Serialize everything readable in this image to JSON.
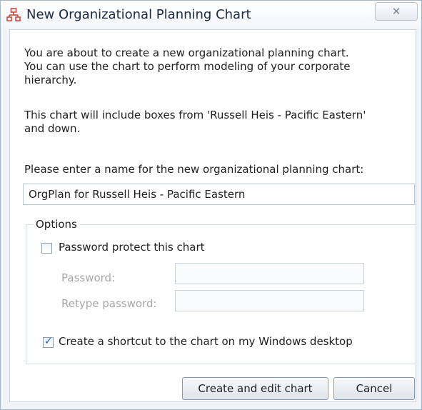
{
  "window": {
    "title": "New Organizational Planning Chart",
    "close_glyph": "✕"
  },
  "intro_text": "You are about to create a new organizational planning chart.\nYou can use the chart to perform modeling of your corporate hierarchy.",
  "scope_text": "This chart will include boxes from 'Russell Heis - Pacific Eastern'\nand down.",
  "name_prompt": "Please enter a name for the new organizational planning chart:",
  "name_value": "OrgPlan for Russell Heis - Pacific Eastern",
  "options": {
    "legend": "Options",
    "password_protect": {
      "label": "Password protect this chart",
      "checked": false
    },
    "password_label": "Password:",
    "retype_label": "Retype password:",
    "shortcut": {
      "label": "Create a shortcut to the chart on my Windows desktop",
      "checked": true,
      "mark": "✓"
    }
  },
  "buttons": {
    "create": "Create and edit chart",
    "cancel": "Cancel"
  },
  "colors": {
    "accent": "#2a5db0",
    "icon": "#d0453a"
  },
  "icons": {
    "title": "org-chart-icon",
    "close": "close-icon"
  }
}
